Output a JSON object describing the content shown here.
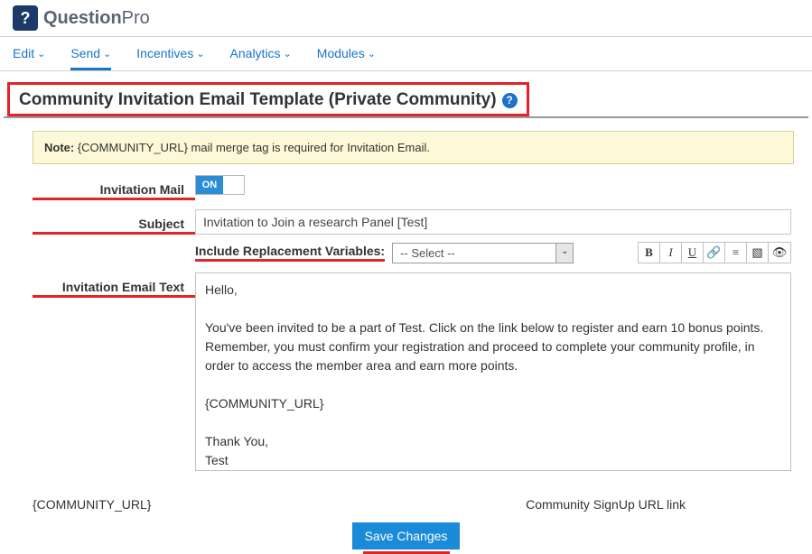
{
  "brand": {
    "mark": "?",
    "name_bold": "Question",
    "name_light": "Pro"
  },
  "menu": {
    "items": [
      {
        "label": "Edit"
      },
      {
        "label": "Send"
      },
      {
        "label": "Incentives"
      },
      {
        "label": "Analytics"
      },
      {
        "label": "Modules"
      }
    ],
    "active": 1
  },
  "page_title": "Community Invitation Email Template (Private Community)",
  "note": {
    "prefix": "Note:",
    "text": " {COMMUNITY_URL} mail merge tag is required for Invitation Email."
  },
  "form": {
    "invitation_mail_label": "Invitation Mail",
    "toggle_on": "ON",
    "subject_label": "Subject",
    "subject_value": "Invitation to Join a research Panel [Test]",
    "include_label": "Include Replacement Variables:",
    "select_placeholder": "-- Select --",
    "email_text_label": "Invitation Email Text",
    "email_body": "Hello,\n\nYou've been invited to be a part of Test. Click on the link below to register and earn 10 bonus points. Remember, you must confirm your registration and proceed to complete your community profile, in order to access the member area and earn more points.\n\n{COMMUNITY_URL}\n\nThank You,\nTest\nFor more information please email : user@questionpro.com"
  },
  "toolbar": {
    "bold": "B",
    "italic": "I",
    "underline": "U",
    "link": "🔗",
    "align": "≡",
    "image": "▧",
    "preview": "👁"
  },
  "footer": {
    "left": "{COMMUNITY_URL}",
    "right": "Community SignUp URL link"
  },
  "save_label": "Save Changes"
}
